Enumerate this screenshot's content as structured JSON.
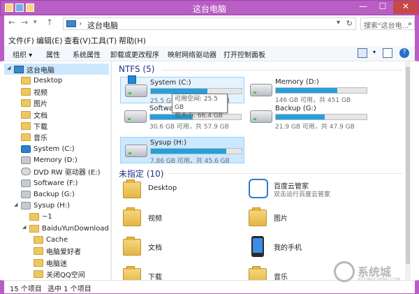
{
  "window": {
    "title": "这台电脑",
    "min": "—",
    "max": "☐",
    "close": "✕"
  },
  "address": {
    "path": "这台电脑",
    "search_placeholder": "搜索\"这台电...\""
  },
  "menu": [
    "文件(F)",
    "编辑(E)",
    "查看(V)",
    "工具(T)",
    "帮助(H)"
  ],
  "toolbar": [
    "组织 ▾",
    "属性",
    "系统属性",
    "卸载或更改程序",
    "映射网络驱动器",
    "打开控制面板"
  ],
  "nav": [
    {
      "label": "这台电脑",
      "icon": "computer",
      "indent": 0,
      "selected": true
    },
    {
      "label": "Desktop",
      "icon": "folder",
      "indent": 1
    },
    {
      "label": "视频",
      "icon": "folder",
      "indent": 1
    },
    {
      "label": "图片",
      "icon": "folder",
      "indent": 1
    },
    {
      "label": "文档",
      "icon": "folder",
      "indent": 1
    },
    {
      "label": "下载",
      "icon": "folder",
      "indent": 1
    },
    {
      "label": "音乐",
      "icon": "folder",
      "indent": 1
    },
    {
      "label": "System (C:)",
      "icon": "drive-win",
      "indent": 1
    },
    {
      "label": "Memory (D:)",
      "icon": "drive",
      "indent": 1
    },
    {
      "label": "DVD RW 驱动器 (E:)",
      "icon": "dvd",
      "indent": 1
    },
    {
      "label": "Software (F:)",
      "icon": "drive",
      "indent": 1
    },
    {
      "label": "Backup (G:)",
      "icon": "drive",
      "indent": 1
    },
    {
      "label": "Sysup (H:)",
      "icon": "drive",
      "indent": 1
    },
    {
      "label": "~1",
      "icon": "folder",
      "indent": 2
    },
    {
      "label": "BaiduYunDownload",
      "icon": "folder",
      "indent": 2
    },
    {
      "label": "Cache",
      "icon": "folder",
      "indent": 3
    },
    {
      "label": "电脑爱好者",
      "icon": "folder",
      "indent": 3
    },
    {
      "label": "电脑迷",
      "icon": "folder",
      "indent": 3
    },
    {
      "label": "关闭QQ空间",
      "icon": "folder",
      "indent": 3
    }
  ],
  "groups": {
    "ntfs": "NTFS (5)",
    "unspecified": "未指定 (10)"
  },
  "drives": [
    {
      "name": "System (C:)",
      "free": "25.5 GB 可用，共 66.4 GB",
      "used_fraction": 0.62,
      "win": true,
      "selected": false
    },
    {
      "name": "Memory (D:)",
      "free": "146 GB 可用，共 451 GB",
      "used_fraction": 0.68,
      "win": false,
      "selected": false
    },
    {
      "name": "Software (F:)",
      "free": "30.6 GB 可用，共 57.9 GB",
      "used_fraction": 0.47,
      "win": false,
      "selected": false
    },
    {
      "name": "Backup (G:)",
      "free": "21.9 GB 可用，共 47.9 GB",
      "used_fraction": 0.54,
      "win": false,
      "selected": false
    },
    {
      "name": "Sysup (H:)",
      "free": "7.86 GB 可用，共 45.6 GB",
      "used_fraction": 0.83,
      "win": false,
      "selected": true
    }
  ],
  "tooltip": {
    "line1": "可用空间: 25.5 GB",
    "line2": "总大小: 66.4 GB"
  },
  "folders": [
    {
      "name": "Desktop",
      "icon": "folder-blue"
    },
    {
      "name": "百度云管家",
      "sub": "双击运行百度云管家",
      "icon": "baidu"
    },
    {
      "name": "视频",
      "icon": "folder-video"
    },
    {
      "name": "图片",
      "icon": "folder-pictures"
    },
    {
      "name": "文档",
      "icon": "folder-docs"
    },
    {
      "name": "我的手机",
      "icon": "phone"
    },
    {
      "name": "下载",
      "icon": "folder-download"
    },
    {
      "name": "音乐",
      "icon": "folder-music"
    }
  ],
  "status": {
    "count": "15 个项目",
    "selected": "选中 1 个项目"
  },
  "watermark": {
    "text": "系统城",
    "sub": "XITONGCHENG.COM"
  }
}
